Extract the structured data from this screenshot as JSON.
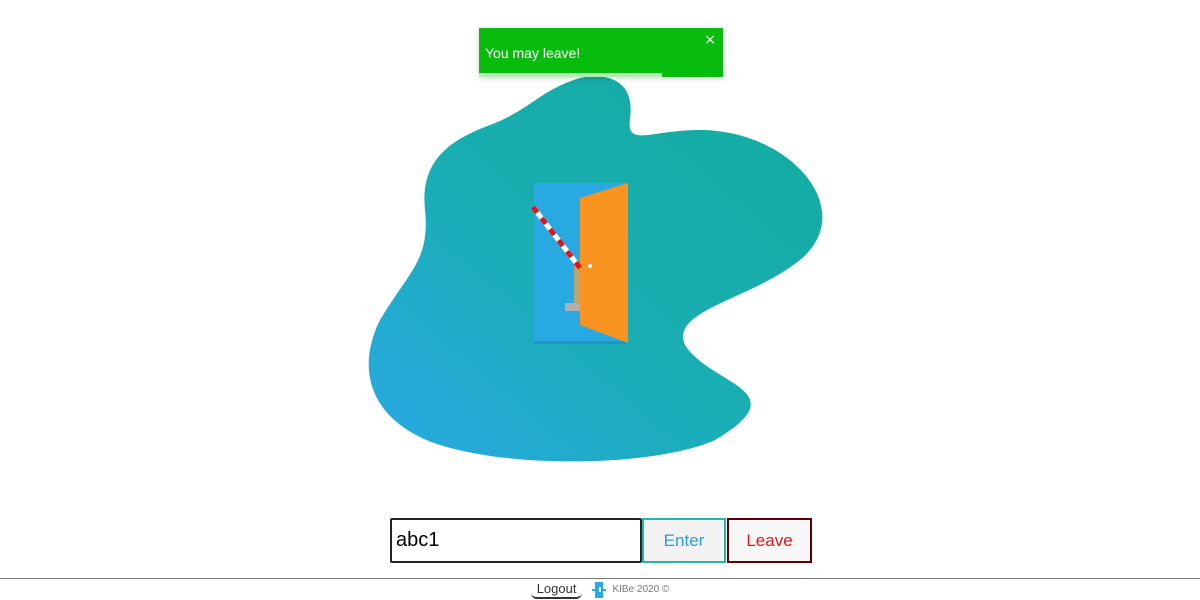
{
  "toast": {
    "message": "You may leave!",
    "close_glyph": "×",
    "progress_fraction": 0.75,
    "color": "#07bc0c"
  },
  "illustration": {
    "blob_gradient": [
      "#2aa8e6",
      "#12ab9c"
    ],
    "door_frame_color": "#29a9e1",
    "door_color": "#f7931e",
    "barrier_colors": [
      "#e01515",
      "#ffffff"
    ]
  },
  "form": {
    "code_value": "abc1",
    "enter_label": "Enter",
    "leave_label": "Leave"
  },
  "footer": {
    "logout_label": "Logout",
    "logo_icon": "door-logo-icon",
    "copyright": "KIBe 2020 ©"
  }
}
